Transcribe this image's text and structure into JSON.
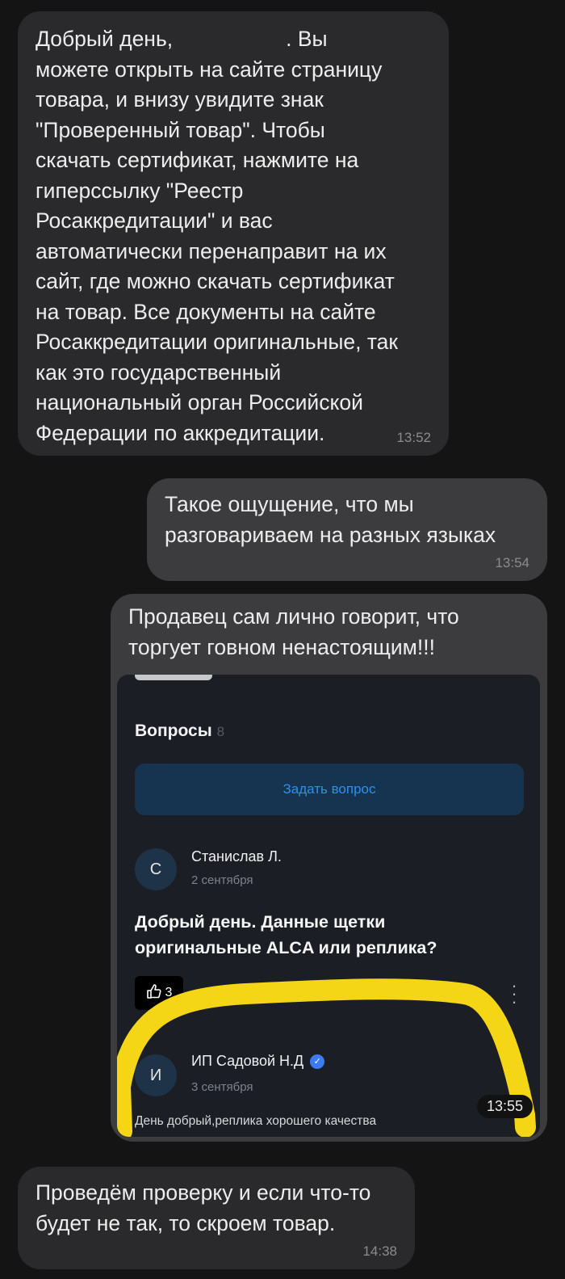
{
  "messages": [
    {
      "direction": "incoming",
      "lines": [
        "Добрый день,",
        "можете открыть на сайте страницу",
        "товара, и внизу увидите знак",
        "\"Проверенный товар\". Чтобы",
        "скачать сертификат, нажмите на",
        "гиперссылку \"Реестр",
        "Росаккредитации\" и вас",
        "автоматически перенаправит на их",
        "сайт, где можно скачать сертификат",
        "на товар. Все документы на сайте",
        "Росаккредитации оригинальные, так",
        "как это государственный",
        "национальный орган Российской",
        "Федерации по аккредитации."
      ],
      "line1_tail": ". Вы",
      "time": "13:52"
    },
    {
      "direction": "outgoing",
      "lines": [
        "Такое ощущение, что мы",
        "разговариваем на разных языках"
      ],
      "time": "13:54"
    },
    {
      "direction": "outgoing",
      "lines": [
        "Продавец сам лично говорит, что",
        "торгует говном ненастоящим!!!"
      ],
      "time": "13:55",
      "screenshot": {
        "section_title": "Вопросы",
        "question_count": "8",
        "ask_button": "Задать вопрос",
        "question": {
          "avatar_letter": "С",
          "author": "Станислав Л.",
          "date": "2 сентября",
          "text_lines": [
            "Добрый день. Данные щетки",
            "оригинальные ALCA или реплика?"
          ],
          "likes": "3"
        },
        "answer": {
          "avatar_letter": "И",
          "author": "ИП Садовой Н.Д",
          "date": "3 сентября",
          "text": "День добрый,реплика хорошего качества"
        },
        "highlight_color": "#f5d617"
      }
    },
    {
      "direction": "incoming",
      "lines": [
        "Проведём проверку и если что-то",
        "будет не так, то скроем товар."
      ],
      "time": "14:38"
    }
  ],
  "colors": {
    "background": "#141414",
    "incoming_bubble": "#2a2a2c",
    "outgoing_bubble": "#3c3c3e",
    "link_blue": "#2f8ff0"
  }
}
